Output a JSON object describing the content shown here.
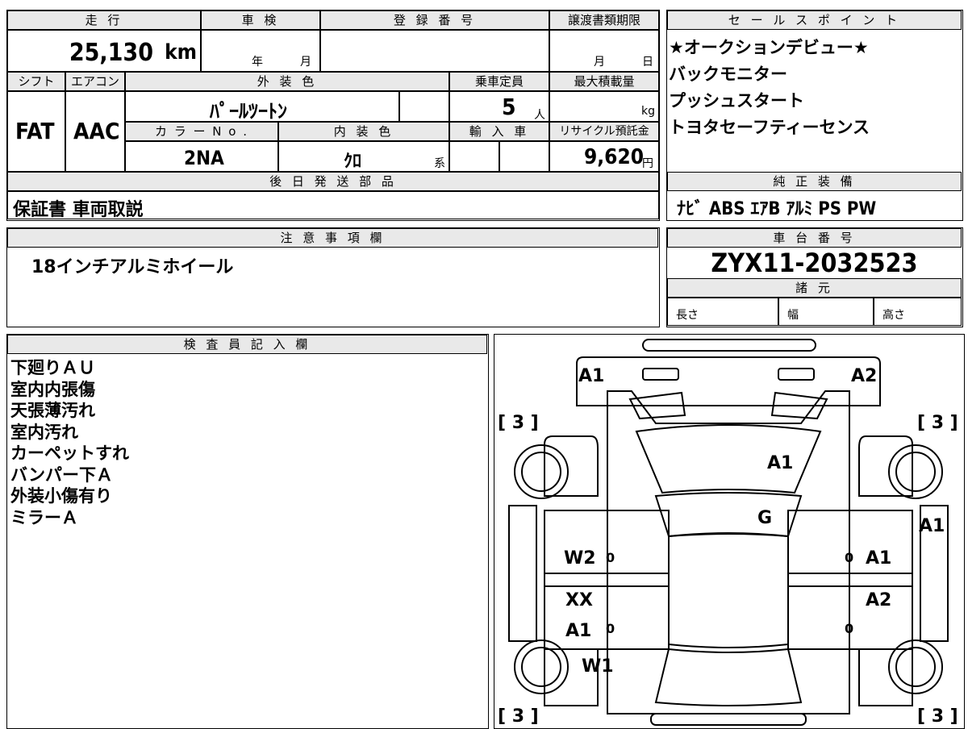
{
  "top_specs": {
    "mileage_label": "走 行",
    "mileage_value": "25,130",
    "mileage_unit": "km",
    "inspection_label": "車 検",
    "inspection_year": "年",
    "inspection_month": "月",
    "registration_label": "登 録 番 号",
    "transfer_label": "譲渡書類期限",
    "transfer_month": "月",
    "transfer_day": "日",
    "shift_label": "シフト",
    "shift_value": "FAT",
    "ac_label": "エアコン",
    "ac_value": "AAC",
    "exterior_label": "外 装 色",
    "exterior_value": "ﾊﾟｰﾙﾂｰﾄﾝ",
    "capacity_label": "乗車定員",
    "capacity_value": "5",
    "capacity_unit": "人",
    "maxload_label": "最大積載量",
    "maxload_unit": "kg",
    "color_no_label": "カ ラ ー N o .",
    "color_no_value": "2NA",
    "interior_label": "内 装 色",
    "interior_value": "ｸﾛ",
    "interior_unit": "系",
    "import_label": "輸 入 車",
    "recycle_label": "リサイクル預託金",
    "recycle_value": "9,620",
    "recycle_unit": "円",
    "later_parts_label": "後 日 発 送 部 品",
    "later_parts_value": "保証書 車両取説"
  },
  "sales_points": {
    "label": "セ ー ル ス ポ イ ン ト",
    "items": [
      "★オークションデビュー★",
      "バックモニター",
      "プッシュスタート",
      "トヨタセーフティーセンス"
    ]
  },
  "equipment": {
    "label": "純 正 装 備",
    "value": "ﾅﾋﾞ ABS ｴｱB ｱﾙﾐ PS PW"
  },
  "notes": {
    "label": "注 意 事 項 欄",
    "value": "18インチアルミホイール"
  },
  "chassis": {
    "label": "車 台 番 号",
    "value": "ZYX11-2032523",
    "specs_label": "諸 元",
    "length_label": "長さ",
    "width_label": "幅",
    "height_label": "高さ"
  },
  "inspector": {
    "label": "検 査 員 記 入 欄",
    "lines": [
      "下廻りＡＵ",
      "室内内張傷",
      "天張薄汚れ",
      "室内汚れ",
      "カーペットすれ",
      "バンパー下Ａ",
      "外装小傷有り",
      "ミラーＡ"
    ]
  },
  "diagram": {
    "marks": [
      "A1",
      "A2",
      "A1",
      "G",
      "A1",
      "W2",
      "A1",
      "XX",
      "A2",
      "A1",
      "W1"
    ],
    "tire_tread": [
      "[ 3 ]",
      "[ 3 ]",
      "[ 3 ]",
      "[ 3 ]"
    ],
    "zero_marks": [
      "0",
      "0",
      "0",
      "0"
    ]
  }
}
